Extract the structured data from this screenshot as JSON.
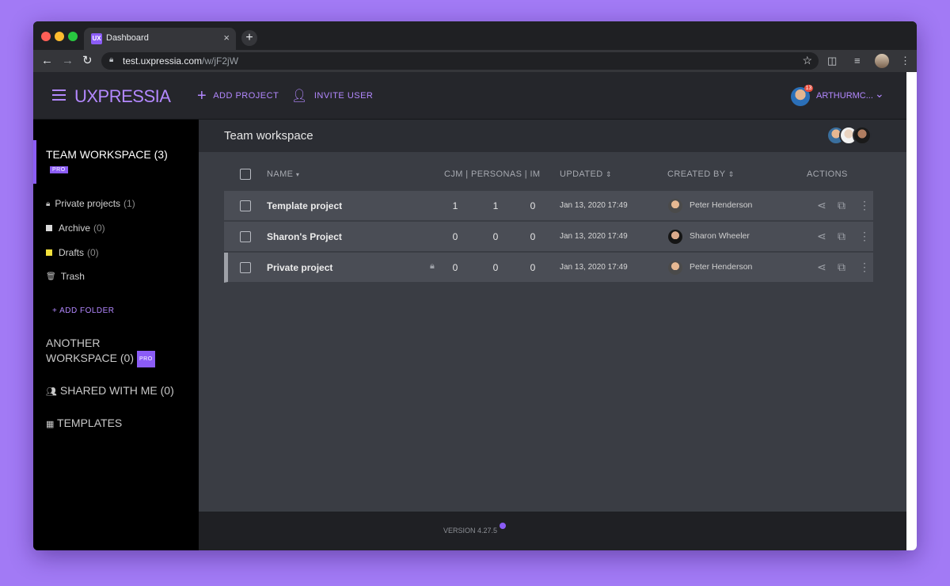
{
  "browser": {
    "tab_title": "Dashboard",
    "tab_favicon_text": "UX",
    "tab_close": "×",
    "new_tab": "+",
    "url_host": "test.uxpressia.com",
    "url_path": "/w/jF2jW",
    "icons": [
      "back-icon",
      "forward-icon",
      "reload-icon",
      "lock-icon",
      "star-icon",
      "pocket-icon",
      "media-icon",
      "profile-avatar",
      "menu-dots-icon"
    ]
  },
  "header": {
    "logo": "UXPRESSIA",
    "add_project": "ADD PROJECT",
    "invite_user": "INVITE USER",
    "username": "ARTHURMC...",
    "notification_count": "13",
    "accent": "#b388ff"
  },
  "sidebar": {
    "active_workspace": "TEAM WORKSPACE (3)",
    "pro": "PRO",
    "items": [
      {
        "label": "Private projects",
        "count": "(1)",
        "icon": "lock-icon"
      },
      {
        "label": "Archive",
        "count": "(0)",
        "icon": "square-icon",
        "color": "#d9d9d9"
      },
      {
        "label": "Drafts",
        "count": "(0)",
        "icon": "square-icon",
        "color": "#f3e13c"
      },
      {
        "label": "Trash",
        "count": "",
        "icon": "trash-icon"
      }
    ],
    "add_folder": "+  ADD FOLDER",
    "another_workspace_line1": "ANOTHER",
    "another_workspace_line2": "WORKSPACE (0)",
    "shared": "SHARED WITH ME (0)",
    "templates": "TEMPLATES"
  },
  "main": {
    "workspace_title": "Team workspace",
    "columns": {
      "name": "NAME",
      "counts": "CJM | PERSONAS | IM",
      "updated": "UPDATED",
      "created_by": "CREATED BY",
      "actions": "ACTIONS"
    },
    "rows": [
      {
        "name": "Template project",
        "cjm": "1",
        "personas": "1",
        "im": "0",
        "updated": "Jan 13, 2020 17:49",
        "creator": "Peter Henderson"
      },
      {
        "name": "Sharon's Project",
        "cjm": "0",
        "personas": "0",
        "im": "0",
        "updated": "Jan 13, 2020 17:49",
        "creator": "Sharon Wheeler"
      },
      {
        "name": "Private project",
        "cjm": "0",
        "personas": "0",
        "im": "0",
        "updated": "Jan 13, 2020 17:49",
        "creator": "Peter Henderson",
        "locked": true
      }
    ],
    "version": "VERSION 4.27.5"
  }
}
